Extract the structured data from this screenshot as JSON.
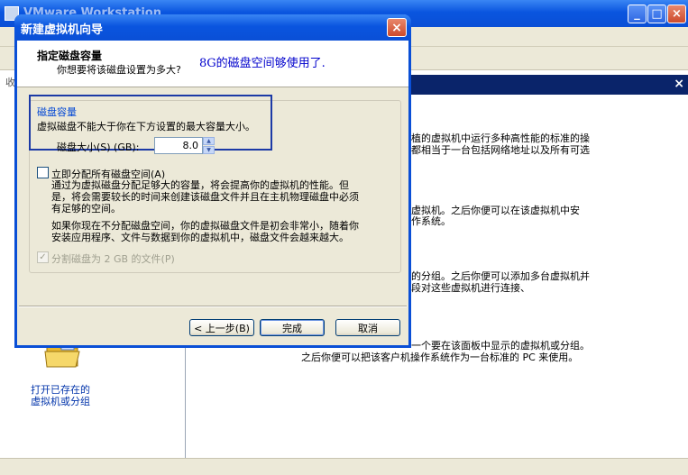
{
  "main_window": {
    "title": "VMware Workstation",
    "minimize_glyph": "_",
    "maximize_glyph": "□",
    "close_glyph": "×",
    "left_pane_label": "收",
    "content_close_glyph": "×",
    "content_lines": [
      "植的虚拟机中运行多种高性能的标准的操",
      "都相当于一台包括网络地址以及所有可选",
      "虚拟机。之后你便可以在该虚拟机中安",
      "作系统。",
      "的分组。之后你便可以添加多台虚拟机并",
      "段对这些虚拟机进行连接、",
      "一个要在该面板中显示的虚拟机或分组。",
      "之后你便可以把该客户机操作系统作为一台标准的 PC 来使用。"
    ],
    "open_existing_line1": "打开已存在的",
    "open_existing_line2": "虚拟机或分组",
    "folder_icon": "folder-open-icon"
  },
  "dialog": {
    "title": "新建虚拟机向导",
    "close_glyph": "×",
    "header_title": "指定磁盘容量",
    "header_subtitle": "你想要将该磁盘设置为多大?",
    "handwritten_note": "8G的磁盘空间够使用了.",
    "group_title": "磁盘容量",
    "capacity_desc": "虚拟磁盘不能大于你在下方设置的最大容量大小。",
    "disk_size_label": "磁盘大小(S) (GB):",
    "disk_size_value": "8.0",
    "allocate_label": "立即分配所有磁盘空间(A)",
    "allocate_desc": [
      "通过为虚拟磁盘分配足够大的容量，将会提高你的虚拟机的性能。但",
      "是，将会需要较长的时间来创建该磁盘文件并且在主机物理磁盘中必须",
      "有足够的空间。"
    ],
    "dynamic_desc": [
      "如果你现在不分配磁盘空间，你的虚拟磁盘文件是初会非常小，随着你",
      "安装应用程序、文件与数据到你的虚拟机中，磁盘文件会越来越大。"
    ],
    "split_label": "分割磁盘为 2 GB 的文件(P)",
    "split_checked_glyph": "✓",
    "back_button": "< 上一步(B)",
    "finish_button": "完成",
    "cancel_button": "取消"
  },
  "colors": {
    "titlebar": "#0A55DF",
    "accent_label": "#0046D5",
    "note_ink": "#0000CC",
    "highlight_border": "#1C3AA6"
  }
}
